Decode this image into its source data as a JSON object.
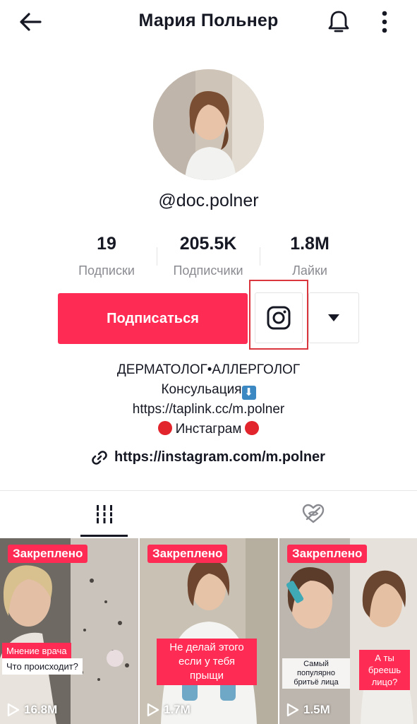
{
  "header": {
    "title": "Мария Польнер"
  },
  "profile": {
    "username": "@doc.polner"
  },
  "stats": [
    {
      "value": "19",
      "label": "Подписки"
    },
    {
      "value": "205.5K",
      "label": "Подписчики"
    },
    {
      "value": "1.8M",
      "label": "Лайки"
    }
  ],
  "actions": {
    "follow_label": "Подписаться"
  },
  "bio": {
    "line1": "ДЕРМАТОЛОГ•АЛЛЕРГОЛОГ",
    "line2": "Консульация",
    "line2_emoji": "⬇",
    "line3": "https://taplink.cc/m.polner",
    "line4": "Инстаграм"
  },
  "link": {
    "url": "https://instagram.com/m.polner"
  },
  "videos": [
    {
      "pinned_label": "Закреплено",
      "captions": [
        "Мнение врача",
        "Что происходит?"
      ],
      "views": "16.8M"
    },
    {
      "pinned_label": "Закреплено",
      "captions": [
        "Не делай этого если у тебя прыщи"
      ],
      "views": "1.7M"
    },
    {
      "pinned_label": "Закреплено",
      "captions": [
        "Самый популярно бритьё лица",
        "А ты бреешь лицо?"
      ],
      "views": "1.5M"
    }
  ],
  "colors": {
    "accent": "#fe2c55",
    "text": "#161823",
    "muted": "#8a8b91",
    "highlight": "#d9363e"
  },
  "icons": {
    "back": "arrow-left-icon",
    "bell": "bell-icon",
    "more": "more-vertical-icon",
    "instagram": "instagram-icon",
    "dropdown": "caret-down-icon",
    "link": "link-icon",
    "grid_tab": "grid-icon",
    "liked_tab": "heart-hidden-icon",
    "play": "play-icon"
  }
}
